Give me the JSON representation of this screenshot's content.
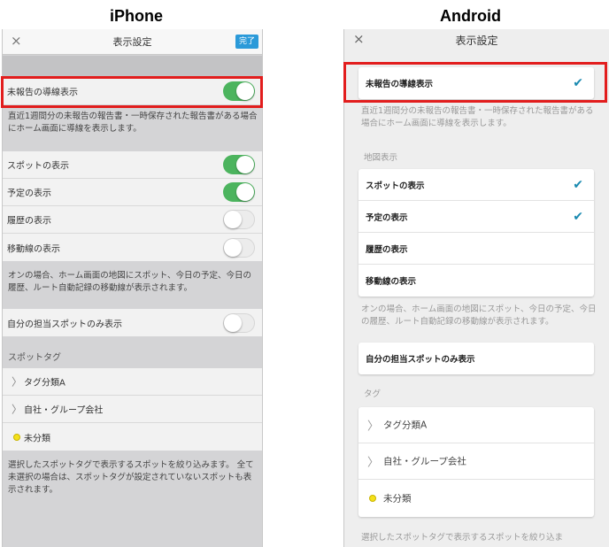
{
  "ios": {
    "platform_title": "iPhone",
    "nav": {
      "close_icon": "×",
      "title": "表示設定",
      "done_label": "完了"
    },
    "guide_toggle": {
      "label": "未報告の導線表示",
      "state": "on"
    },
    "guide_desc": "直近1週間分の未報告の報告書・一時保存された報告書がある場合にホーム画面に導線を表示します。",
    "map_toggles": [
      {
        "label": "スポットの表示",
        "state": "on"
      },
      {
        "label": "予定の表示",
        "state": "on"
      },
      {
        "label": "履歴の表示",
        "state": "off"
      },
      {
        "label": "移動線の表示",
        "state": "off"
      }
    ],
    "map_desc": "オンの場合、ホーム画面の地図にスポット、今日の予定、今日の履歴、ルート自動記録の移動線が表示されます。",
    "own_spots_toggle": {
      "label": "自分の担当スポットのみ表示",
      "state": "off"
    },
    "tag_section_header": "スポットタグ",
    "tags": [
      {
        "label": "タグ分類A",
        "icon": "chevron-right-icon"
      },
      {
        "label": "自社・グループ会社",
        "icon": "chevron-right-icon"
      },
      {
        "label": "未分類",
        "icon": "yellow-dot-icon"
      }
    ],
    "tag_desc": "選択したスポットタグで表示するスポットを絞り込みます。 全て未選択の場合は、スポットタグが設定されていないスポットも表示されます。"
  },
  "android": {
    "platform_title": "Android",
    "nav": {
      "close_icon": "×",
      "title": "表示設定"
    },
    "guide_item": {
      "label": "未報告の導線表示",
      "checked": true
    },
    "guide_desc": "直近1週間分の未報告の報告書・一時保存された報告書がある場合にホーム画面に導線を表示します。",
    "map_section_header": "地図表示",
    "map_items": [
      {
        "label": "スポットの表示",
        "checked": true
      },
      {
        "label": "予定の表示",
        "checked": true
      },
      {
        "label": "履歴の表示",
        "checked": false
      },
      {
        "label": "移動線の表示",
        "checked": false
      }
    ],
    "map_desc": "オンの場合、ホーム画面の地図にスポット、今日の予定、今日の履歴、ルート自動記録の移動線が表示されます。",
    "own_spots_item": {
      "label": "自分の担当スポットのみ表示"
    },
    "tag_section_header": "タグ",
    "tags": [
      {
        "label": "タグ分類A",
        "icon": "chevron-right-icon"
      },
      {
        "label": "自社・グループ会社",
        "icon": "chevron-right-icon"
      },
      {
        "label": "未分類",
        "icon": "yellow-dot-icon"
      }
    ],
    "tag_desc": "選択したスポットタグで表示するスポットを絞り込ま"
  },
  "colors": {
    "toggle_on": "#4cb45e",
    "accent_blue": "#2b9ad9",
    "check_color": "#1a8ab0",
    "highlight_red": "#e21d1d",
    "tag_dot": "#f4e01a"
  }
}
